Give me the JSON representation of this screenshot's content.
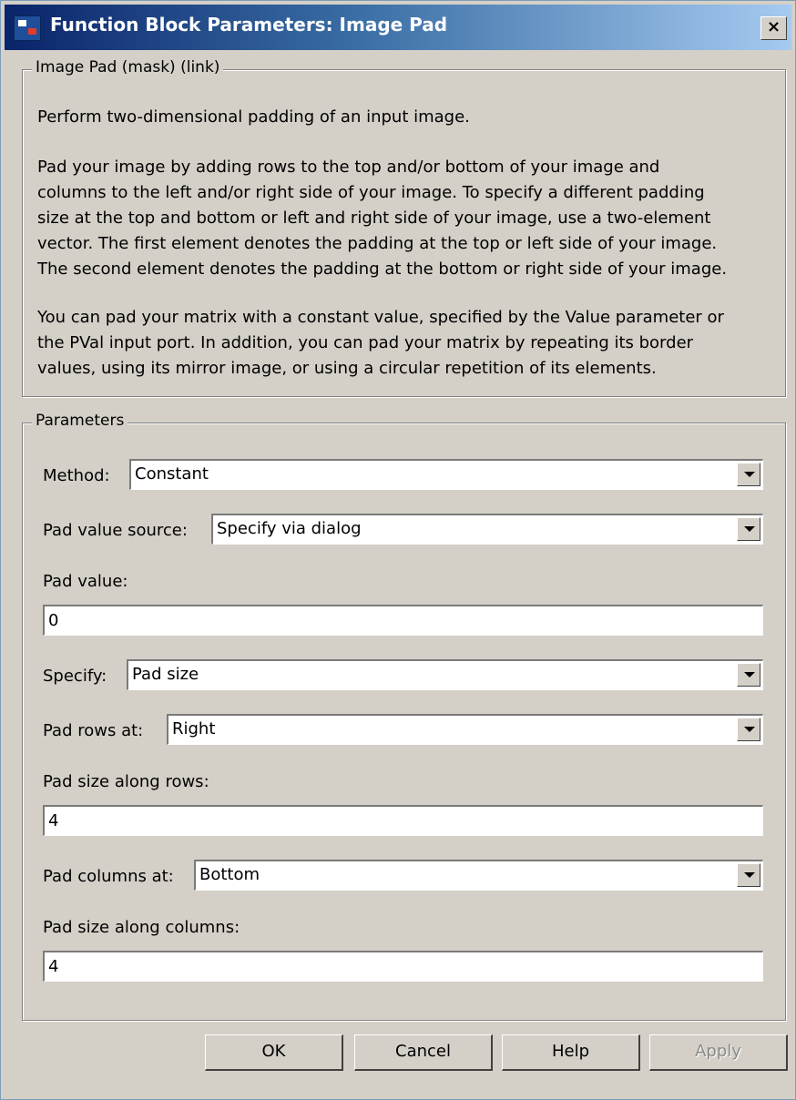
{
  "window": {
    "title": "Function Block Parameters: Image Pad",
    "close_label": "×"
  },
  "description": {
    "legend": "Image Pad (mask) (link)",
    "paragraphs": [
      "Perform two-dimensional padding of an input image.",
      "Pad your image by adding rows to the top and/or bottom of your image and\ncolumns to the left and/or right side of your image. To specify a different padding\nsize at the top and bottom or left and right side of your image, use a two-element\nvector. The first element denotes the padding at the top or left side of your image.\nThe second element denotes the padding at the bottom or right side of your image.",
      "You can pad your matrix with a constant value, specified by the Value parameter or\nthe PVal input port. In addition, you can pad your matrix by repeating its border\nvalues, using its mirror image, or using a circular repetition of its elements."
    ]
  },
  "parameters": {
    "legend": "Parameters",
    "method": {
      "label": "Method:",
      "value": "Constant"
    },
    "pad_value_source": {
      "label": "Pad value source:",
      "value": "Specify via dialog"
    },
    "pad_value": {
      "label": "Pad value:",
      "value": "0"
    },
    "specify": {
      "label": "Specify:",
      "value": "Pad size"
    },
    "pad_rows_at": {
      "label": "Pad rows at:",
      "value": "Right"
    },
    "pad_size_rows": {
      "label": "Pad size along rows:",
      "value": "4"
    },
    "pad_columns_at": {
      "label": "Pad columns at:",
      "value": "Bottom"
    },
    "pad_size_columns": {
      "label": "Pad size along columns:",
      "value": "4"
    }
  },
  "buttons": {
    "ok": "OK",
    "cancel": "Cancel",
    "help": "Help",
    "apply": "Apply",
    "apply_enabled": false
  }
}
